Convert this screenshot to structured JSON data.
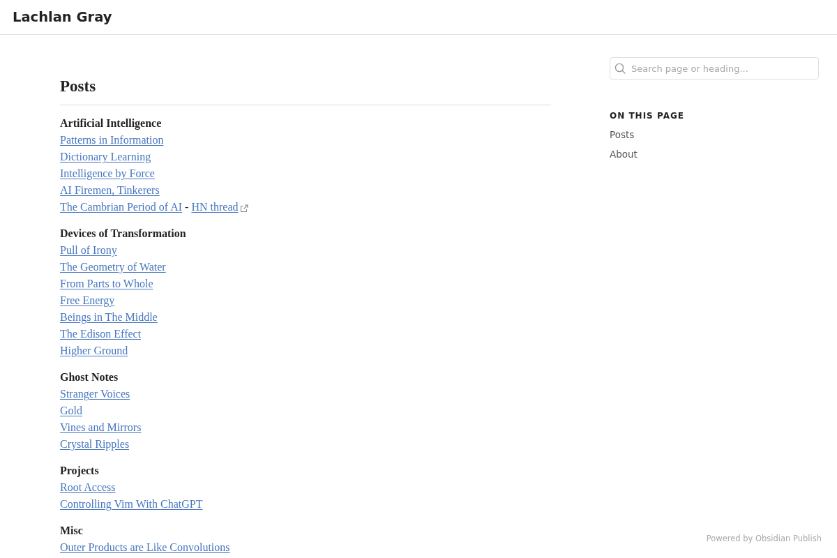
{
  "site_header": {
    "title": "Lachlan Gray"
  },
  "content": {
    "heading": "Posts",
    "sections": [
      {
        "title": "Artificial Intelligence",
        "lines": [
          [
            {
              "kind": "link",
              "text": "Patterns in Information"
            }
          ],
          [
            {
              "kind": "link",
              "text": "Dictionary Learning"
            }
          ],
          [
            {
              "kind": "link",
              "text": "Intelligence by Force"
            }
          ],
          [
            {
              "kind": "link",
              "text": "AI Firemen, Tinkerers"
            }
          ],
          [
            {
              "kind": "link",
              "text": "The Cambrian Period of AI"
            },
            {
              "kind": "text",
              "text": "-"
            },
            {
              "kind": "external_link",
              "text": "HN thread"
            }
          ]
        ]
      },
      {
        "title": "Devices of Transformation",
        "lines": [
          [
            {
              "kind": "link",
              "text": "Pull of Irony"
            }
          ],
          [
            {
              "kind": "link",
              "text": "The Geometry of Water"
            }
          ],
          [
            {
              "kind": "link",
              "text": "From Parts to Whole"
            }
          ],
          [
            {
              "kind": "link",
              "text": "Free Energy"
            }
          ],
          [
            {
              "kind": "link",
              "text": "Beings in The Middle"
            }
          ],
          [
            {
              "kind": "link",
              "text": "The Edison Effect"
            }
          ],
          [
            {
              "kind": "link",
              "text": "Higher Ground"
            }
          ]
        ]
      },
      {
        "title": "Ghost Notes",
        "lines": [
          [
            {
              "kind": "link",
              "text": "Stranger Voices"
            }
          ],
          [
            {
              "kind": "link",
              "text": "Gold"
            }
          ],
          [
            {
              "kind": "link",
              "text": "Vines and Mirrors"
            }
          ],
          [
            {
              "kind": "link",
              "text": "Crystal Ripples"
            }
          ]
        ]
      },
      {
        "title": "Projects",
        "lines": [
          [
            {
              "kind": "link",
              "text": "Root Access"
            }
          ],
          [
            {
              "kind": "link",
              "text": "Controlling Vim With ChatGPT"
            }
          ]
        ]
      },
      {
        "title": "Misc",
        "lines": [
          [
            {
              "kind": "link",
              "text": "Outer Products are Like Convolutions"
            }
          ]
        ]
      }
    ]
  },
  "sidebar": {
    "search": {
      "placeholder": "Search page or heading..."
    },
    "toc": {
      "title": "ON THIS PAGE",
      "items": [
        "Posts",
        "About"
      ]
    }
  },
  "footer": {
    "text": "Powered by Obsidian Publish"
  }
}
